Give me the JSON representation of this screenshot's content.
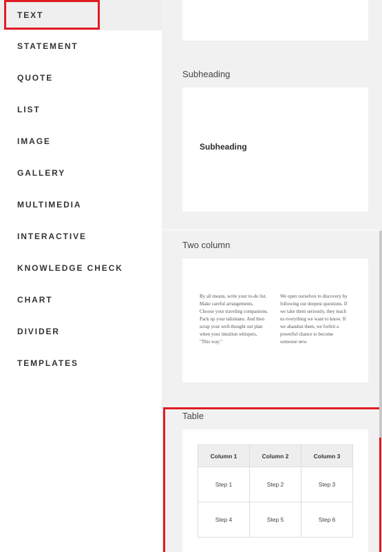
{
  "sidebar": {
    "items": [
      {
        "label": "TEXT"
      },
      {
        "label": "STATEMENT"
      },
      {
        "label": "QUOTE"
      },
      {
        "label": "LIST"
      },
      {
        "label": "IMAGE"
      },
      {
        "label": "GALLERY"
      },
      {
        "label": "MULTIMEDIA"
      },
      {
        "label": "INTERACTIVE"
      },
      {
        "label": "KNOWLEDGE CHECK"
      },
      {
        "label": "CHART"
      },
      {
        "label": "DIVIDER"
      },
      {
        "label": "TEMPLATES"
      }
    ],
    "active": "TEXT"
  },
  "blocks": {
    "subheading": {
      "label": "Subheading",
      "preview_text": "Subheading"
    },
    "two_column": {
      "label": "Two column",
      "left_text": "By all means, write your to-do list. Make careful arrangements. Choose your traveling companions. Pack up your talismans. And then scrap your well-thought out plan when your intuition whispers, \"This way.\"",
      "right_text": "We open ourselves to discovery by following our deepest questions. If we take them seriously, they teach us everything we want to know. If we abandon them, we forfeit a powerful chance to become someone new."
    },
    "table": {
      "label": "Table",
      "headers": [
        "Column 1",
        "Column 2",
        "Column 3"
      ],
      "rows": [
        [
          "Step 1",
          "Step 2",
          "Step 3"
        ],
        [
          "Step 4",
          "Step 5",
          "Step 6"
        ]
      ]
    }
  },
  "colors": {
    "highlight": "#e11b22"
  }
}
